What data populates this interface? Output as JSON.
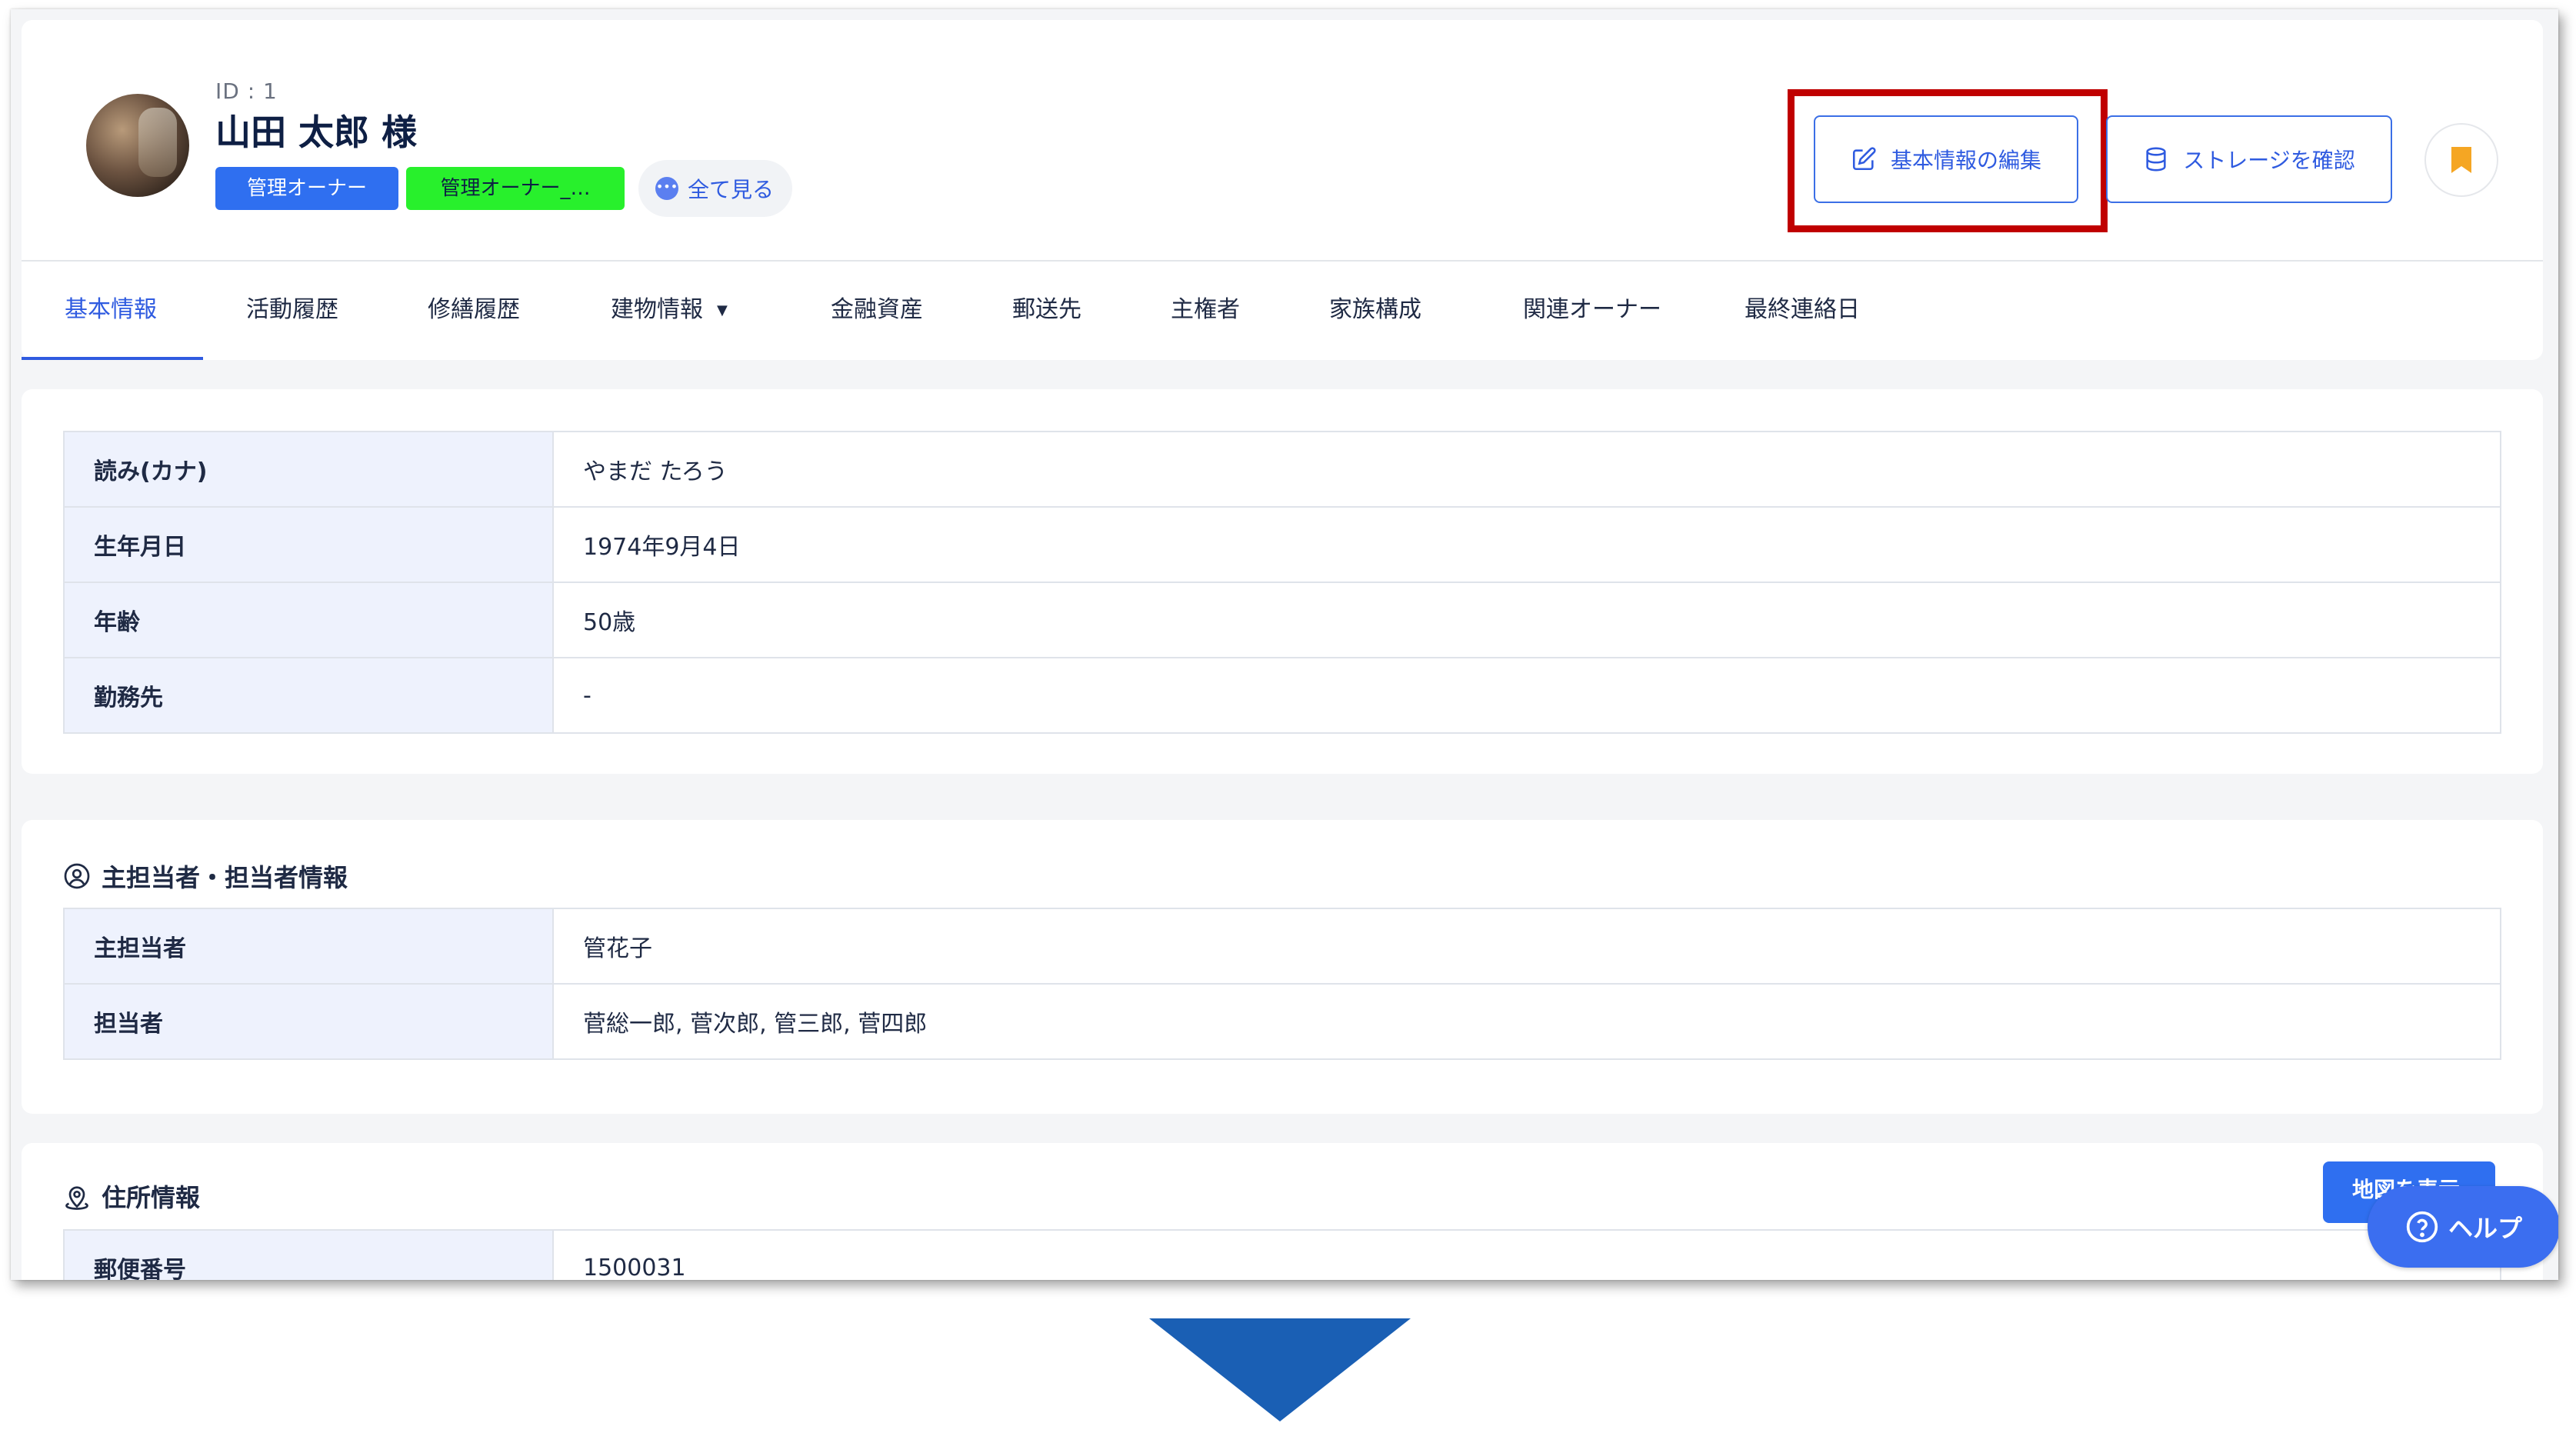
{
  "owner": {
    "id": "ID : 1",
    "name": "山田 太郎 様",
    "tags": [
      "管理オーナー",
      "管理オーナー_…"
    ],
    "see_all": "全て見る"
  },
  "actions": {
    "edit_label": "基本情報の編集",
    "storage_label": "ストレージを確認"
  },
  "tabs": [
    "基本情報",
    "活動履歴",
    "修繕履歴",
    "建物情報",
    "金融資産",
    "郵送先",
    "主権者",
    "家族構成",
    "関連オーナー",
    "最終連絡日"
  ],
  "basic_info": [
    {
      "label": "読み(カナ)",
      "value": "やまだ たろう"
    },
    {
      "label": "生年月日",
      "value": "1974年9月4日"
    },
    {
      "label": "年齢",
      "value": "50歳"
    },
    {
      "label": "勤務先",
      "value": "-"
    }
  ],
  "staff_section": {
    "title": "主担当者・担当者情報",
    "rows": [
      {
        "label": "主担当者",
        "value": "管花子"
      },
      {
        "label": "担当者",
        "value": "菅総一郎, 菅次郎, 管三郎, 菅四郎"
      }
    ]
  },
  "address_section": {
    "title": "住所情報",
    "rows": [
      {
        "label": "郵便番号",
        "value": "1500031"
      }
    ],
    "map_button": "地図を表示"
  },
  "help_label": "ヘルプ",
  "colors": {
    "primary": "#2f5be0",
    "tag_blue": "#2f6ff0",
    "tag_green": "#28f02c",
    "highlight": "#c00000",
    "bookmark": "#f5a623",
    "arrow": "#1a5fb4"
  }
}
